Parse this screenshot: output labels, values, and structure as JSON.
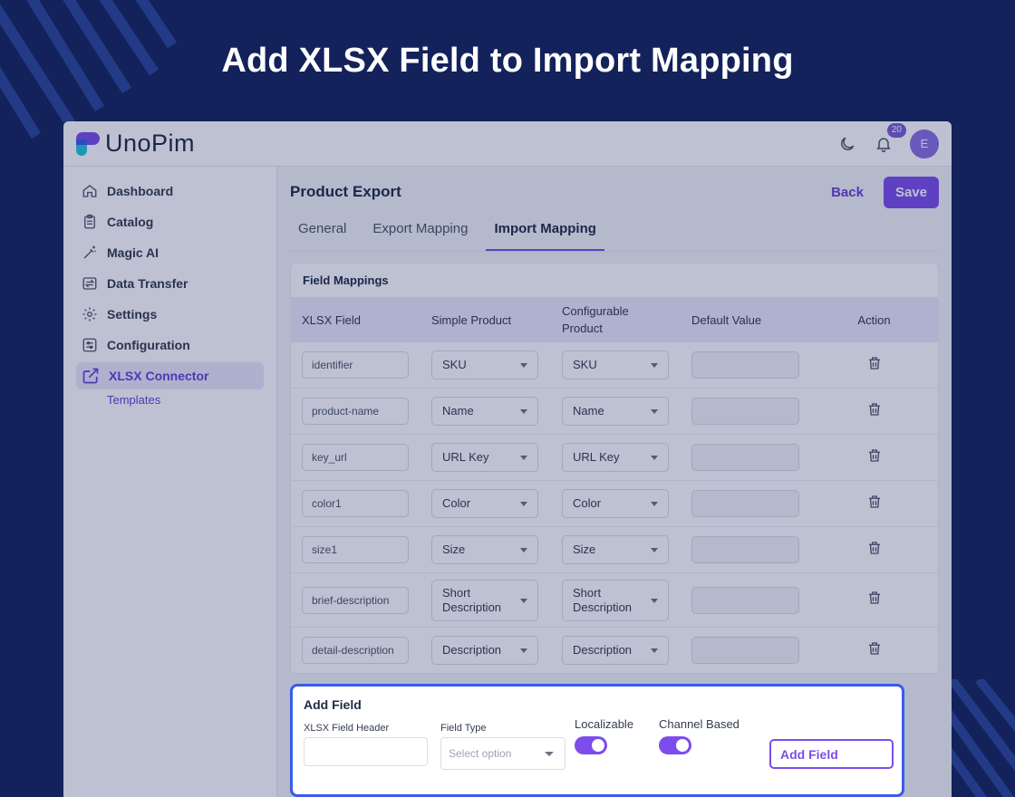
{
  "hero": {
    "title": "Add XLSX Field to Import Mapping"
  },
  "app": {
    "logo_text": "UnoPim",
    "notifications_count": "20",
    "avatar_initial": "E"
  },
  "sidebar": {
    "items": [
      {
        "label": "Dashboard",
        "icon": "home-icon"
      },
      {
        "label": "Catalog",
        "icon": "clipboard-icon"
      },
      {
        "label": "Magic AI",
        "icon": "magic-wand-icon"
      },
      {
        "label": "Data Transfer",
        "icon": "transfer-icon"
      },
      {
        "label": "Settings",
        "icon": "gear-icon"
      },
      {
        "label": "Configuration",
        "icon": "sliders-icon"
      },
      {
        "label": "XLSX Connector",
        "icon": "export-icon",
        "active": true
      }
    ],
    "sub_item": "Templates"
  },
  "page": {
    "title": "Product Export",
    "back_label": "Back",
    "save_label": "Save",
    "tabs": [
      "General",
      "Export Mapping",
      "Import Mapping"
    ],
    "active_tab": "Import Mapping"
  },
  "mappings": {
    "title": "Field Mappings",
    "columns": [
      "XLSX Field",
      "Simple Product",
      "Configurable Product",
      "Default Value",
      "Action"
    ],
    "rows": [
      {
        "xlsx": "identifier",
        "simple": "SKU",
        "configurable": "SKU"
      },
      {
        "xlsx": "product-name",
        "simple": "Name",
        "configurable": "Name"
      },
      {
        "xlsx": "key_url",
        "simple": "URL Key",
        "configurable": "URL Key"
      },
      {
        "xlsx": "color1",
        "simple": "Color",
        "configurable": "Color"
      },
      {
        "xlsx": "size1",
        "simple": "Size",
        "configurable": "Size"
      },
      {
        "xlsx": "brief-description",
        "simple": "Short Description",
        "configurable": "Short Description"
      },
      {
        "xlsx": "detail-description",
        "simple": "Description",
        "configurable": "Description"
      }
    ]
  },
  "add_field": {
    "title": "Add Field",
    "header_label": "XLSX Field Header",
    "type_label": "Field Type",
    "type_placeholder": "Select option",
    "localizable_label": "Localizable",
    "localizable_on": true,
    "channel_label": "Channel Based",
    "channel_on": true,
    "button_label": "Add Field"
  },
  "colors": {
    "brand": "#7c4dea",
    "background": "#13225a",
    "modal_border": "#3b5be8"
  }
}
